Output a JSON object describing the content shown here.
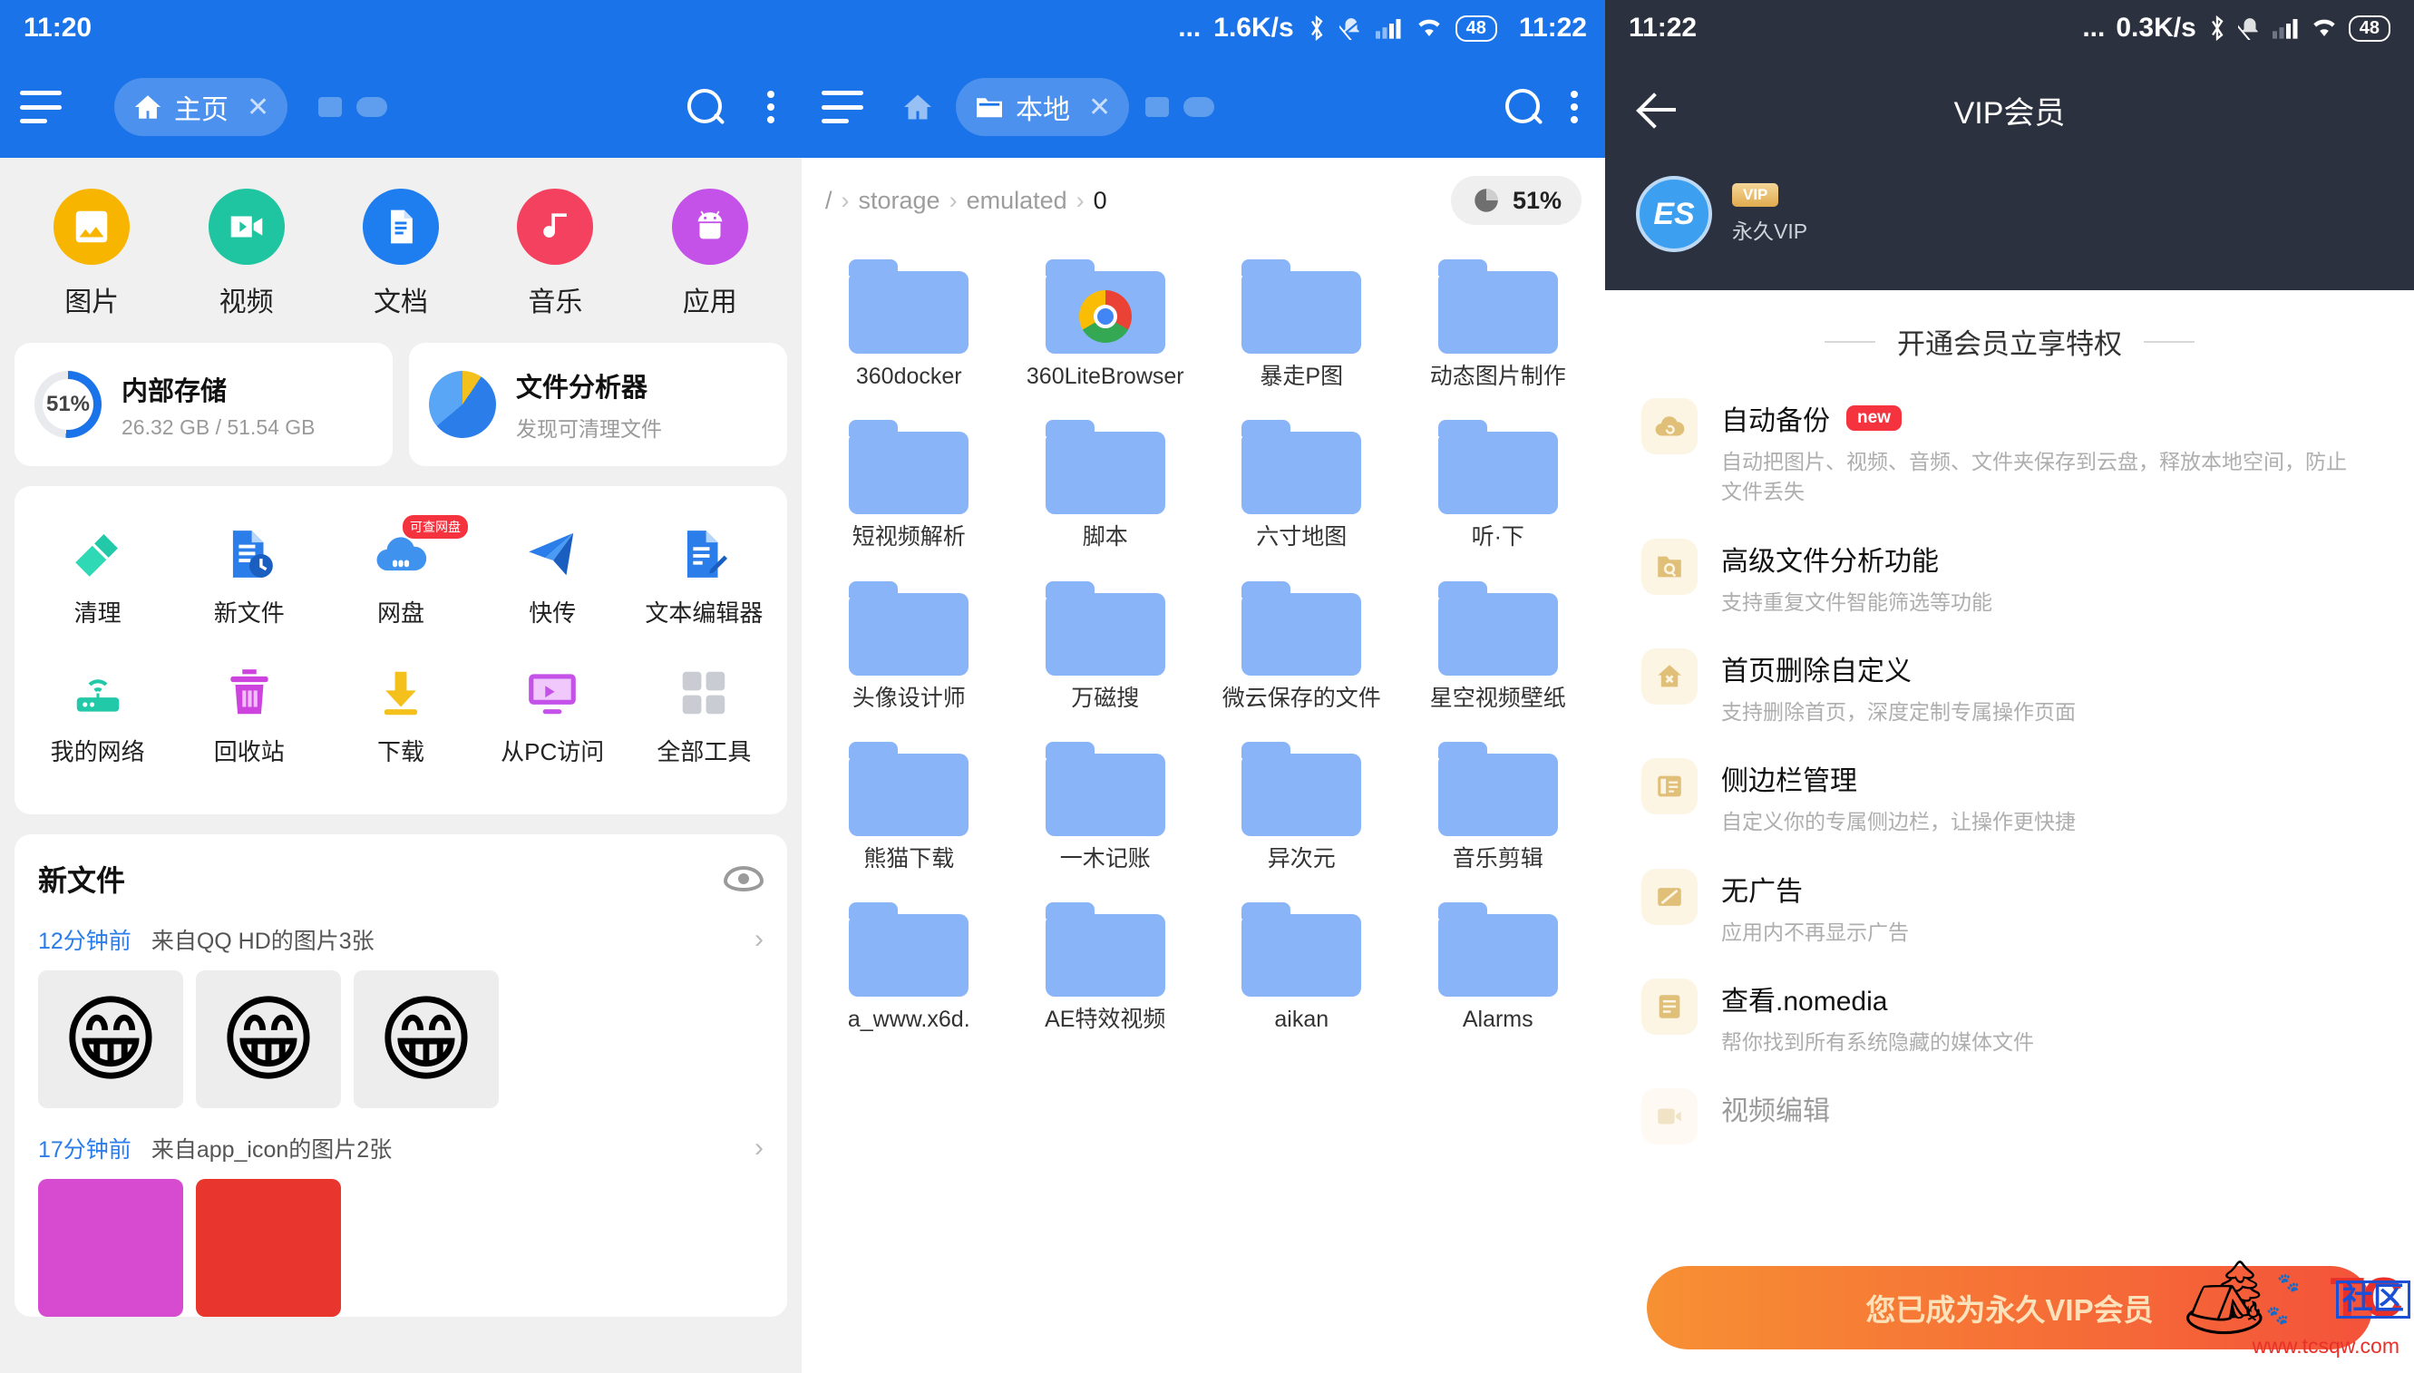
{
  "home": {
    "status": {
      "time": "11:20"
    },
    "appbar": {
      "menu_icon": "hamburger-icon",
      "tab_label": "主页",
      "tab_home_icon": "home-icon",
      "tab_close_icon": "close-icon",
      "search_icon": "search-icon",
      "overflow_icon": "more-vertical-icon"
    },
    "categories": [
      {
        "label": "图片",
        "icon": "image-icon",
        "color": "#f7b500"
      },
      {
        "label": "视频",
        "icon": "video-icon",
        "color": "#1fc4a0"
      },
      {
        "label": "文档",
        "icon": "document-icon",
        "color": "#1e7ef0"
      },
      {
        "label": "音乐",
        "icon": "music-icon",
        "color": "#f4415f"
      },
      {
        "label": "应用",
        "icon": "android-icon",
        "color": "#c552e8"
      }
    ],
    "storage_card": {
      "percent_label": "51%",
      "percent": 51,
      "title": "内部存储",
      "subtitle": "26.32 GB / 51.54 GB",
      "icon": "storage-ring-icon",
      "accent": "#1a73e8"
    },
    "analyzer_card": {
      "title": "文件分析器",
      "subtitle": "发现可清理文件",
      "icon": "pie-chart-icon"
    },
    "tools": [
      {
        "label": "清理",
        "icon": "broom-icon",
        "color": "#22c9a8"
      },
      {
        "label": "新文件",
        "icon": "new-file-icon",
        "color": "#2b7de9"
      },
      {
        "label": "网盘",
        "icon": "cloud-disk-icon",
        "color": "#3f93ee",
        "badge": "可查网盘"
      },
      {
        "label": "快传",
        "icon": "send-icon",
        "color": "#2b7de9"
      },
      {
        "label": "文本编辑器",
        "icon": "text-editor-icon",
        "color": "#2b7de9"
      },
      {
        "label": "我的网络",
        "icon": "network-icon",
        "color": "#1fc4a0"
      },
      {
        "label": "回收站",
        "icon": "trash-icon",
        "color": "#cc43dd"
      },
      {
        "label": "下载",
        "icon": "download-icon",
        "color": "#f4c01c"
      },
      {
        "label": "从PC访问",
        "icon": "pc-access-icon",
        "color": "#c552e8"
      },
      {
        "label": "全部工具",
        "icon": "grid-icon",
        "color": "#c9ccd2"
      }
    ],
    "new_files": {
      "title": "新文件",
      "eye_icon": "eye-icon",
      "entries": [
        {
          "time": "12分钟前",
          "desc": "来自QQ HD的图片3张",
          "arrow_icon": "chevron-right-icon",
          "thumbs": [
            {
              "glyph": "😁",
              "bg": "#ededed"
            },
            {
              "glyph": "😁",
              "bg": "#ededed",
              "gray": true
            },
            {
              "glyph": "😁",
              "bg": "#ededed"
            }
          ]
        },
        {
          "time": "17分钟前",
          "desc": "来自app_icon的图片2张",
          "arrow_icon": "chevron-right-icon",
          "thumbs": [
            {
              "glyph": "",
              "bg": "#d74bd1"
            },
            {
              "glyph": "",
              "bg": "#e8352e"
            }
          ]
        }
      ]
    }
  },
  "files": {
    "status": {
      "net_speed": "1.6K/s",
      "dots": "...",
      "bluetooth_icon": "bluetooth-icon",
      "mute_icon": "bell-muted-icon",
      "signal_icon": "signal-icon",
      "wifi_icon": "wifi-icon",
      "battery": "48",
      "time": "11:22"
    },
    "appbar": {
      "menu_icon": "hamburger-icon",
      "home_icon": "home-icon",
      "tab_label": "本地",
      "tab_folder_icon": "folder-icon",
      "tab_close_icon": "close-icon",
      "search_icon": "search-icon",
      "overflow_icon": "more-vertical-icon"
    },
    "breadcrumb": {
      "root": "/",
      "parts": [
        "storage",
        "emulated",
        "0"
      ],
      "separator": "›",
      "usage_label": "51%",
      "usage_icon": "pie-chart-icon"
    },
    "items": [
      {
        "name": "360docker",
        "icon": "folder-icon"
      },
      {
        "name": "360LiteBrowser",
        "icon": "folder-icon",
        "overlay": "chrome-logo-icon"
      },
      {
        "name": "暴走P图",
        "icon": "folder-icon"
      },
      {
        "name": "动态图片制作",
        "icon": "folder-icon"
      },
      {
        "name": "短视频解析",
        "icon": "folder-icon"
      },
      {
        "name": "脚本",
        "icon": "folder-icon"
      },
      {
        "name": "六寸地图",
        "icon": "folder-icon"
      },
      {
        "name": "听·下",
        "icon": "folder-icon"
      },
      {
        "name": "头像设计师",
        "icon": "folder-icon"
      },
      {
        "name": "万磁搜",
        "icon": "folder-icon"
      },
      {
        "name": "微云保存的文件",
        "icon": "folder-icon"
      },
      {
        "name": "星空视频壁纸",
        "icon": "folder-icon"
      },
      {
        "name": "熊猫下载",
        "icon": "folder-icon"
      },
      {
        "name": "一木记账",
        "icon": "folder-icon"
      },
      {
        "name": "异次元",
        "icon": "folder-icon"
      },
      {
        "name": "音乐剪辑",
        "icon": "folder-icon"
      },
      {
        "name": "a_www.x6d.",
        "icon": "folder-icon"
      },
      {
        "name": "AE特效视频",
        "icon": "folder-icon"
      },
      {
        "name": "aikan",
        "icon": "folder-icon"
      },
      {
        "name": "Alarms",
        "icon": "folder-icon"
      }
    ]
  },
  "vip": {
    "status": {
      "time": "11:22",
      "net_speed": "0.3K/s",
      "dots": "...",
      "bluetooth_icon": "bluetooth-icon",
      "mute_icon": "bell-muted-icon",
      "signal_icon": "signal-icon",
      "wifi_icon": "wifi-icon",
      "battery": "48"
    },
    "appbar": {
      "back_icon": "back-arrow-icon",
      "title": "VIP会员"
    },
    "profile": {
      "avatar_icon": "es-logo-avatar-icon",
      "vip_tag": "VIP",
      "name": "永久VIP"
    },
    "section_title": "开通会员立享特权",
    "features": [
      {
        "title": "自动备份",
        "badge": "new",
        "icon": "cloud-backup-icon",
        "desc": "自动把图片、视频、音频、文件夹保存到云盘，释放本地空间，防止文件丢失"
      },
      {
        "title": "高级文件分析功能",
        "badge": "",
        "icon": "folder-search-icon",
        "desc": "支持重复文件智能筛选等功能"
      },
      {
        "title": "首页删除自定义",
        "badge": "",
        "icon": "home-x-icon",
        "desc": "支持删除首页，深度定制专属操作页面"
      },
      {
        "title": "侧边栏管理",
        "badge": "",
        "icon": "sidebar-icon",
        "desc": "自定义你的专属侧边栏，让操作更快捷"
      },
      {
        "title": "无广告",
        "badge": "",
        "icon": "no-ads-icon",
        "desc": "应用内不再显示广告"
      },
      {
        "title": "查看.nomedia",
        "badge": "",
        "icon": "nomedia-icon",
        "desc": "帮你找到所有系统隐藏的媒体文件"
      },
      {
        "title": "视频编辑",
        "badge": "",
        "icon": "video-edit-icon",
        "desc": ""
      }
    ],
    "cta_label": "您已成为永久VIP会员",
    "watermark": {
      "brand": "TC",
      "suffix": "社区",
      "url": "www.tcsqw.com",
      "figure_icon": "camper-icon"
    }
  }
}
